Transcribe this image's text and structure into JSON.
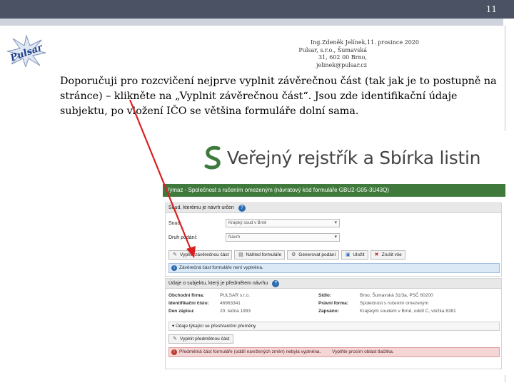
{
  "slide": {
    "page_number": "11",
    "logo_text": "Pulsar",
    "author_lines": [
      "Ing.Zdeněk Jelínek,",
      "Pulsar, s.r.o., Šumavská",
      "31, 602 00 Brno,",
      "jelinek@pulsar.cz"
    ],
    "date": "11. prosince 2020",
    "body_text": "Doporučuji pro rozcvičení nejprve vyplnit závěrečnou část (tak jak je to postupně na stránce) – klikněte na „Vyplnit závěrečnou část“. Jsou zde identifikační údaje subjektu, po vložení IČO se většina formuláře dolní sama."
  },
  "app": {
    "brand_title": "Veřejný rejstřík a Sbírka listin",
    "form_bar": "Výmaz - Společnost s ručením omezeným (návratový kód formuláře GBU2-G05-3U43Q)",
    "court_panel": {
      "title": "Soud, kterému je návrh určen",
      "court_label": "Soud:",
      "court_value": "Krajský soud v Brně",
      "submission_label": "Druh podání:",
      "submission_value": "Návrh"
    },
    "toolbar": {
      "fill_final": "Vyplnit závěrečnou část",
      "preview": "Náhled formuláře",
      "generate": "Generovat podání",
      "save": "Uložit",
      "cancel": "Zrušit vše"
    },
    "info_final": "Závěrečná část formuláře není vyplněna.",
    "subject_panel": {
      "title": "Údaje o subjektu, který je předmětem návrhu",
      "rows": [
        {
          "l1": "Obchodní firma:",
          "v1": "PULSAR s.r.o.",
          "l2": "Sídlo:",
          "v2": "Brno, Šumavská 31/3a, PSČ 60200"
        },
        {
          "l1": "Identifikační číslo:",
          "v1": "46963341",
          "l2": "Právní forma:",
          "v2": "Společnost s ručením omezeným"
        },
        {
          "l1": "Den zápisu:",
          "v1": "20. ledna 1993",
          "l2": "Zapsáno:",
          "v2": "Krajským soudem v Brně, oddíl C, vložka 8381"
        }
      ],
      "sub_header": "Údaje týkající se přeshraniční přeměny",
      "fill_subject": "Vyplnit předmětnou část",
      "error_text": "Předmětná část formuláře (oddíl navržených změn) nebyla vyplněna.",
      "error_action": "Vyplňte prosím oblast tlačítka."
    }
  },
  "colors": {
    "topbar": "#4a5264",
    "green": "#3f7a3c",
    "arrow": "#d92020"
  }
}
